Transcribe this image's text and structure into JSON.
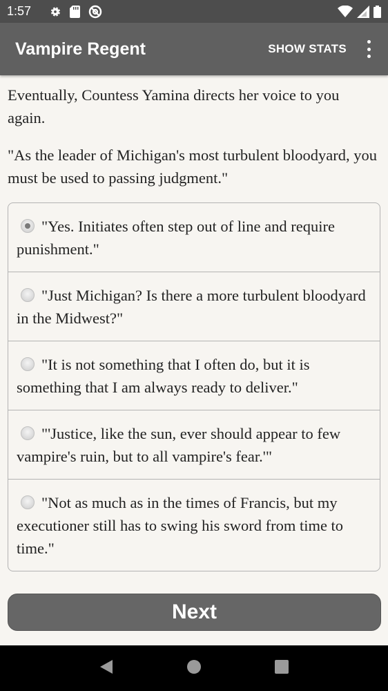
{
  "status": {
    "time": "1:57",
    "left_icons": [
      "gear-icon",
      "sd-card-icon",
      "at-sign-icon"
    ],
    "right_icons": [
      "wifi-icon",
      "signal-icon",
      "battery-icon"
    ]
  },
  "appbar": {
    "title": "Vampire Regent",
    "show_stats_label": "SHOW STATS",
    "menu_icon": "overflow-menu-icon"
  },
  "story": {
    "paragraphs": [
      "Eventually, Countess Yamina directs her voice to you again.",
      "\"As the leader of Michigan's most turbulent bloodyard, you must be used to passing judgment.\""
    ]
  },
  "choices": [
    {
      "text": "\"Yes. Initiates often step out of line and require punishment.\"",
      "selected": true
    },
    {
      "text": "\"Just Michigan? Is there a more turbulent bloodyard in the Midwest?\"",
      "selected": false
    },
    {
      "text": "\"It is not something that I often do, but it is something that I am always ready to deliver.\"",
      "selected": false
    },
    {
      "text": "\"'Justice, like the sun, ever should appear to few vampire's ruin, but to all vampire's fear.'\"",
      "selected": false
    },
    {
      "text": "\"Not as much as in the times of Francis, but my executioner still has to swing his sword from time to time.\"",
      "selected": false
    }
  ],
  "next_label": "Next",
  "nav": [
    "back-icon",
    "home-icon",
    "recents-icon"
  ],
  "colors": {
    "appbar": "#606060",
    "statusbar": "#4d4d4d",
    "background": "#f7f5f1",
    "button": "#666666"
  }
}
